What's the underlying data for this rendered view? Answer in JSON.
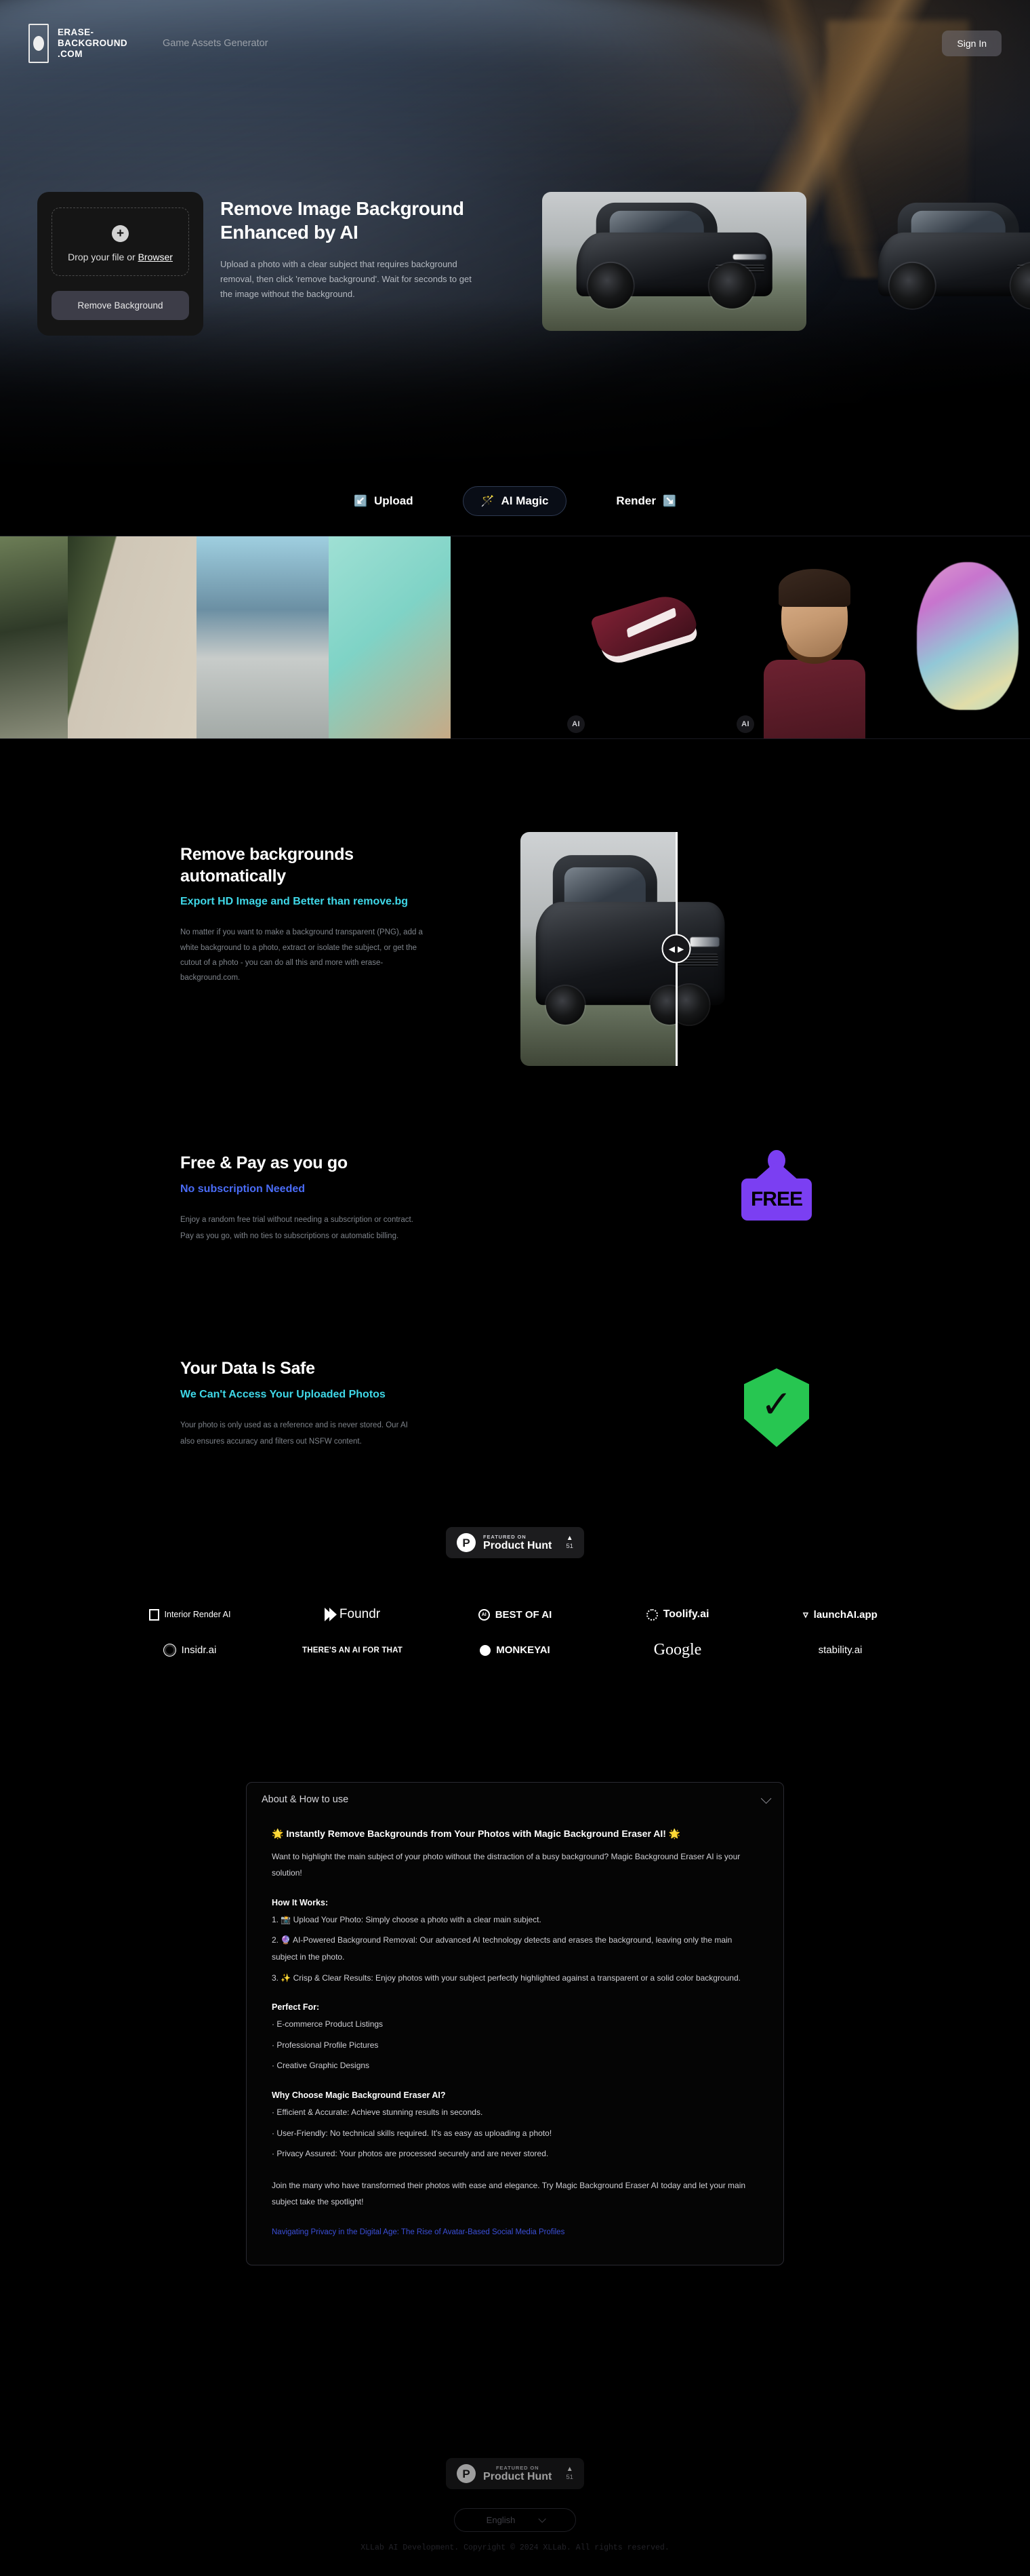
{
  "header": {
    "brand_line1": "ERASE-",
    "brand_line2": "BACKGROUND",
    "brand_line3": ".COM",
    "nav_link": "Game Assets Generator",
    "signin": "Sign In"
  },
  "upload": {
    "drop_prefix": "Drop your file or ",
    "browse": "Browser",
    "plus": "+",
    "button": "Remove Background"
  },
  "hero": {
    "title_line1": "Remove Image Background",
    "title_line2": "Enhanced by AI",
    "subtitle": "Upload a photo with a clear subject that requires background removal, then click 'remove background'. Wait for seconds to get the image without the background."
  },
  "tabs": [
    {
      "label": "Upload",
      "icon": "↙️",
      "icon_name": "down-left-arrow-icon",
      "active": false
    },
    {
      "label": "AI Magic",
      "icon": "🪄",
      "icon_name": "magic-wand-icon",
      "active": true
    },
    {
      "label": "Render",
      "icon": "↘️",
      "icon_name": "down-right-arrow-icon",
      "active": false
    }
  ],
  "gallery": {
    "ai_badge": "AI"
  },
  "features": [
    {
      "title_line1": "Remove backgrounds",
      "title_line2": "automatically",
      "accent": "Export HD Image and Better than remove.bg",
      "accent_color": "#3fd8e8",
      "body": "No matter if you want to make a background transparent (PNG), add a white background to a photo, extract or isolate the subject, or get the cutout of a photo - you can do all this and more with erase-background.com."
    },
    {
      "title_line1": "Free & Pay as you go",
      "accent": "No subscription Needed",
      "accent_color": "#4a6cf7",
      "body_line1": "Enjoy a random free trial without needing a subscription or contract.",
      "body_line2": "Pay as you go, with no ties to subscriptions or automatic billing.",
      "icon_label": "FREE",
      "icon_color": "#7b3ff2"
    },
    {
      "title_line1": "Your Data Is Safe",
      "accent": "We Can't Access Your Uploaded Photos",
      "accent_color": "#3fd8e8",
      "body_line1": "Your photo is only used as a reference and is never stored. Our AI",
      "body_line2": "also ensures accuracy and filters out NSFW content.",
      "icon_color": "#27c651",
      "icon_check": "✓"
    }
  ],
  "product_hunt": {
    "featured_on": "FEATURED ON",
    "name": "Product Hunt",
    "arrow": "▲",
    "count": "51",
    "p": "P"
  },
  "partners": {
    "row1": [
      {
        "name": "Interior Render AI",
        "icon": "box"
      },
      {
        "name": "Foundr",
        "icon": "chevrons"
      },
      {
        "name": "BEST OF AI",
        "icon": "medal"
      },
      {
        "name": "Toolify.ai",
        "icon": "gear"
      },
      {
        "name": "launchAI.app",
        "icon": "rocket"
      }
    ],
    "row2": [
      {
        "name": "Insidr.ai",
        "icon": "ring"
      },
      {
        "name": "THERE'S AN AI FOR THAT",
        "icon": "none"
      },
      {
        "name": "MONKEYAI",
        "icon": "monkey"
      },
      {
        "name": "Google",
        "icon": "none"
      },
      {
        "name": "stability.ai",
        "icon": "none"
      }
    ]
  },
  "accordion": {
    "title": "About & How to use",
    "heading": "🌟 Instantly Remove Backgrounds from Your Photos with Magic Background Eraser AI! 🌟",
    "intro": "Want to highlight the main subject of your photo without the distraction of a busy background? Magic Background Eraser AI is your solution!",
    "how_title": "How It Works:",
    "steps": [
      "1. 📸 Upload Your Photo: Simply choose a photo with a clear main subject.",
      "2. 🔮 AI-Powered Background Removal: Our advanced AI technology detects and erases the background, leaving only the main subject in the photo.",
      "3. ✨ Crisp & Clear Results: Enjoy photos with your subject perfectly highlighted against a transparent or a solid color background."
    ],
    "perfect_title": "Perfect For:",
    "perfect": [
      "· E-commerce Product Listings",
      "· Professional Profile Pictures",
      "· Creative Graphic Designs"
    ],
    "why_title": "Why Choose Magic Background Eraser AI?",
    "why": [
      "· Efficient & Accurate: Achieve stunning results in seconds.",
      "· User-Friendly: No technical skills required. It's as easy as uploading a photo!",
      "· Privacy Assured: Your photos are processed securely and are never stored."
    ],
    "outro": "Join the many who have transformed their photos with ease and elegance. Try Magic Background Eraser AI today and let your main subject take the spotlight!",
    "link": "Navigating Privacy in the Digital Age: The Rise of Avatar-Based Social Media Profiles"
  },
  "footer": {
    "language": "English",
    "copyright": "XLLab AI Development. Copyright © 2024 XLLab. All rights reserved."
  }
}
